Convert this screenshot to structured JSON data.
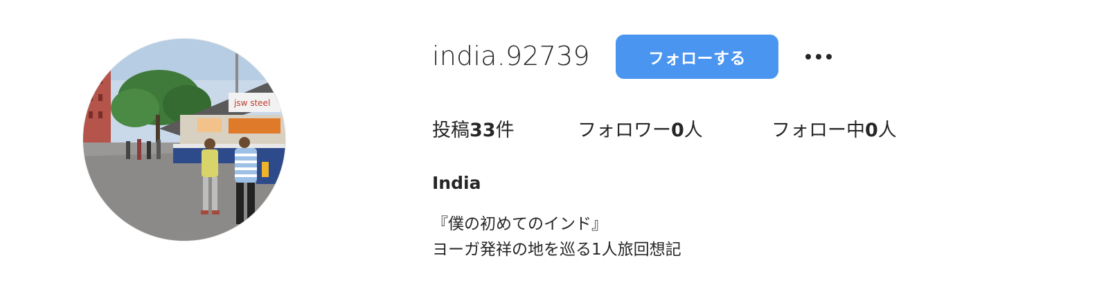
{
  "profile": {
    "username": "india.92739",
    "full_name": "India",
    "bio": [
      "『僕の初めてのインド』",
      "ヨーガ発祥の地を巡る1人旅回想記"
    ],
    "avatar": "profile-photo-street-scene"
  },
  "actions": {
    "follow_label": "フォローする",
    "more_icon": "more-options-icon"
  },
  "stats": {
    "posts": {
      "prefix": "投稿",
      "count": "33",
      "suffix": "件"
    },
    "followers": {
      "prefix": "フォロワー",
      "count": "0",
      "suffix": "人"
    },
    "following": {
      "prefix": "フォロー中",
      "count": "0",
      "suffix": "人"
    }
  },
  "colors": {
    "accent": "#4a95f0",
    "text": "#262626",
    "background": "#ffffff"
  }
}
